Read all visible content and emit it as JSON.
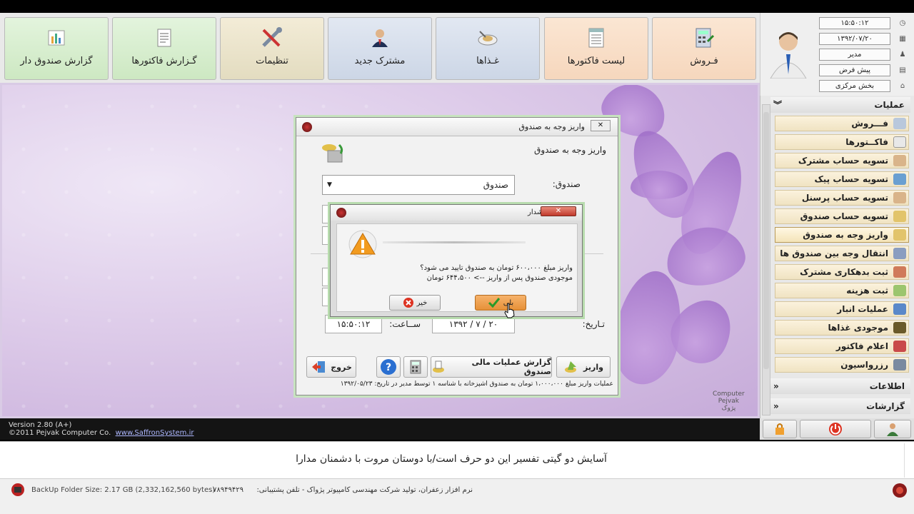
{
  "toolbar": {
    "buttons": [
      {
        "label": "گزارش صندوق دار",
        "icon": "cash-report-icon"
      },
      {
        "label": "گـزارش فاکتورها",
        "icon": "invoice-report-icon"
      },
      {
        "label": "تنظیمات",
        "icon": "settings-tools-icon"
      },
      {
        "label": "مشترک جدید",
        "icon": "new-customer-icon"
      },
      {
        "label": "غـذاها",
        "icon": "food-icon"
      },
      {
        "label": "لیست فاکتورها",
        "icon": "invoice-list-icon"
      },
      {
        "label": "فـروش",
        "icon": "sales-calculator-icon"
      }
    ]
  },
  "header": {
    "time": "۱۵:۵۰:۱۲",
    "date": "۱۳۹۲/۰۷/۲۰",
    "user": "مدیر",
    "profile": "پیش فرض",
    "branch": "بخش مرکزی"
  },
  "sidebar": {
    "operations_title": "عملیات",
    "items": [
      {
        "label": "فـــروش"
      },
      {
        "label": "فاکــتورها"
      },
      {
        "label": "تسویه حساب مشترک اعتباری"
      },
      {
        "label": "تسویه حساب پیک"
      },
      {
        "label": "تسویه حساب پرسنل"
      },
      {
        "label": "تسویه حساب صندوق"
      },
      {
        "label": "واریز وجه به صندوق"
      },
      {
        "label": "انتقال وجه بین صندوق ها"
      },
      {
        "label": "ثبت بدهکاری مشترک"
      },
      {
        "label": "ثبت هزینه"
      },
      {
        "label": "عملیات انبار"
      },
      {
        "label": "موجودی غذاها"
      },
      {
        "label": "اعلام فاکتور"
      },
      {
        "label": "رزرواسیون"
      }
    ],
    "info_title": "اطلاعات",
    "reports_title": "گزارشات"
  },
  "deposit_dialog": {
    "title": "واریز وجه به صندوق",
    "heading": "واریز وجه به صندوق",
    "fund_label": "صندوق:",
    "fund_value": "صندوق",
    "date_label": "تـاریخ:",
    "date_value": "۱۳۹۲ / ۷ / ۲۰",
    "time_label": "ســاعت:",
    "time_value": "۱۵:۵۰:۱۲",
    "btn_deposit": "واریز",
    "btn_report": "گزارش عملیات مالی صندوق",
    "btn_exit": "خروج",
    "info_line": "عملیات واریز مبلغ ۱،۰۰۰،۰۰۰ تومان به صندوق آشپزخانه با شناسه ۱ توسط مدیر در تاریخ: ۱۳۹۲/۰۵/۲۳"
  },
  "warning_dialog": {
    "title": "هشدار",
    "message_line1": "واریز مبلغ ۶۰۰،۰۰۰ تومان به صندوق تایید می شود؟",
    "message_line2": "موجودی صندوق پس از واریز --> ۶۴۴،۵۰۰ تومان",
    "btn_yes": "بلی",
    "btn_no": "خیر"
  },
  "status": {
    "version": "Version 2.80 (A+)",
    "copyright": "©2011 Pejvak Computer Co.",
    "website": "www.SaffronSystem.ir"
  },
  "quote": "آسایش دو گیتی تفسیر این دو حرف است/با دوستان مروت با دشمنان مدارا",
  "footer": {
    "backup": "BackUp Folder Size: 2.17 GB (2,332,162,560 bytes)",
    "phone": "۷۸۹۴۹۴۲۹",
    "credit": "نرم افزار زعفران، تولید شرکت مهندسی کامپیوتر پژواک - تلفن پشتیبانی:"
  },
  "brand": {
    "line1": "Computer",
    "line2": "Pejvak",
    "line3": "پژوک"
  },
  "colors": {
    "accent_green": "#c7e3bf",
    "warning_orange": "#e69138",
    "status_bar": "#141414"
  }
}
